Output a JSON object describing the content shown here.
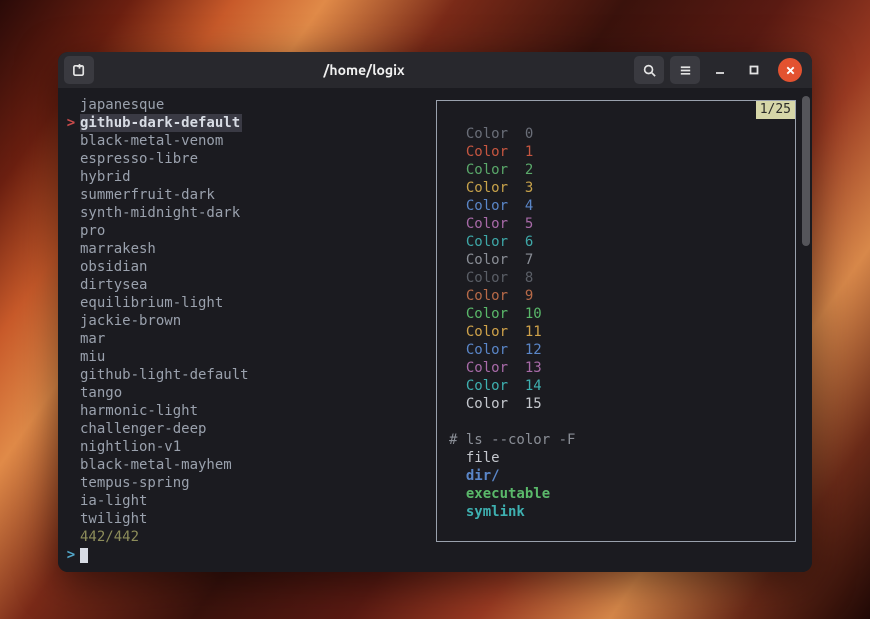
{
  "window_title": "/home/logix",
  "list": {
    "counter": "442/442",
    "selected_index": 1,
    "items": [
      "japanesque",
      "github-dark-default",
      "black-metal-venom",
      "espresso-libre",
      "hybrid",
      "summerfruit-dark",
      "synth-midnight-dark",
      "pro",
      "marrakesh",
      "obsidian",
      "dirtysea",
      "equilibrium-light",
      "jackie-brown",
      "mar",
      "miu",
      "github-light-default",
      "tango",
      "harmonic-light",
      "challenger-deep",
      "nightlion-v1",
      "black-metal-mayhem",
      "tempus-spring",
      "ia-light",
      "twilight"
    ]
  },
  "prompt": {
    "symbol": ">"
  },
  "preview": {
    "badge": "1/25",
    "colors": [
      {
        "label": "Color",
        "n": "0",
        "color": "#6a6e78"
      },
      {
        "label": "Color",
        "n": "1",
        "color": "#c65640"
      },
      {
        "label": "Color",
        "n": "2",
        "color": "#5aa86a"
      },
      {
        "label": "Color",
        "n": "3",
        "color": "#c7a24a"
      },
      {
        "label": "Color",
        "n": "4",
        "color": "#5a86c8"
      },
      {
        "label": "Color",
        "n": "5",
        "color": "#a86aa8"
      },
      {
        "label": "Color",
        "n": "6",
        "color": "#3ea8a8"
      },
      {
        "label": "Color",
        "n": "7",
        "color": "#8a8e96"
      },
      {
        "label": "Color",
        "n": "8",
        "color": "#5a5e66"
      },
      {
        "label": "Color",
        "n": "9",
        "color": "#b86a48"
      },
      {
        "label": "Color",
        "n": "10",
        "color": "#5ab86a"
      },
      {
        "label": "Color",
        "n": "11",
        "color": "#cfa24a"
      },
      {
        "label": "Color",
        "n": "12",
        "color": "#5a86c8"
      },
      {
        "label": "Color",
        "n": "13",
        "color": "#a86aa8"
      },
      {
        "label": "Color",
        "n": "14",
        "color": "#3eb0b0"
      },
      {
        "label": "Color",
        "n": "15",
        "color": "#c5c8ce"
      }
    ],
    "ls_header": "# ls --color -F",
    "ls_lines": [
      {
        "text": "file",
        "color": "#c5c8ce"
      },
      {
        "text": "dir/",
        "color": "#5a86c8",
        "bold": true
      },
      {
        "text": "executable",
        "color": "#5ab86a",
        "bold": true
      },
      {
        "text": "symlink",
        "color": "#3eb0b0",
        "bold": true
      }
    ]
  }
}
